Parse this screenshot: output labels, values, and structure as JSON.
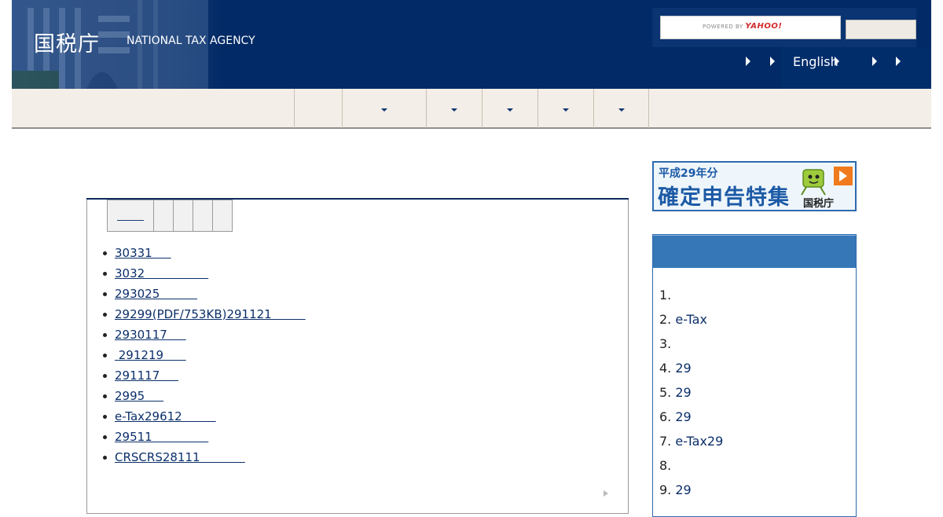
{
  "header": {
    "logo_kanji": "国税庁",
    "logo_english": "NATIONAL TAX AGENCY",
    "search": {
      "powered_by": "POWERED BY",
      "provider": "YAHOO!",
      "button_label": ""
    },
    "utility_links": {
      "english": "English"
    }
  },
  "nav": {
    "items": [
      "",
      "",
      "",
      "",
      "",
      ""
    ]
  },
  "main": {
    "title": "",
    "tabs": [
      "",
      "",
      "",
      "",
      ""
    ],
    "news": [
      "30331     ",
      "3032                 ",
      "293025          ",
      "29299(PDF/753KB)291121         ",
      "2930117     ",
      " 291219      ",
      "291117     ",
      "2995     ",
      "e-Tax29612         ",
      "29511               ",
      "CRSCRS28111            "
    ]
  },
  "sidebar": {
    "banner": {
      "small": "平成29年分",
      "big": "確定申告特集",
      "agency": "国税庁"
    },
    "ranking": {
      "title": "",
      "items": [
        {
          "num": "1.",
          "text": ""
        },
        {
          "num": "2.",
          "text": "e-Tax"
        },
        {
          "num": "3.",
          "text": ""
        },
        {
          "num": "4.",
          "text": "29"
        },
        {
          "num": "5.",
          "text": "29"
        },
        {
          "num": "6.",
          "text": "29"
        },
        {
          "num": "7.",
          "text": "e-Tax29"
        },
        {
          "num": "8.",
          "text": ""
        },
        {
          "num": "9.",
          "text": "29"
        }
      ]
    }
  },
  "colors": {
    "header_navy": "#022a66",
    "nav_beige": "#f3eee7",
    "link": "#0b2f6a",
    "ranking_head": "#3677b8"
  }
}
